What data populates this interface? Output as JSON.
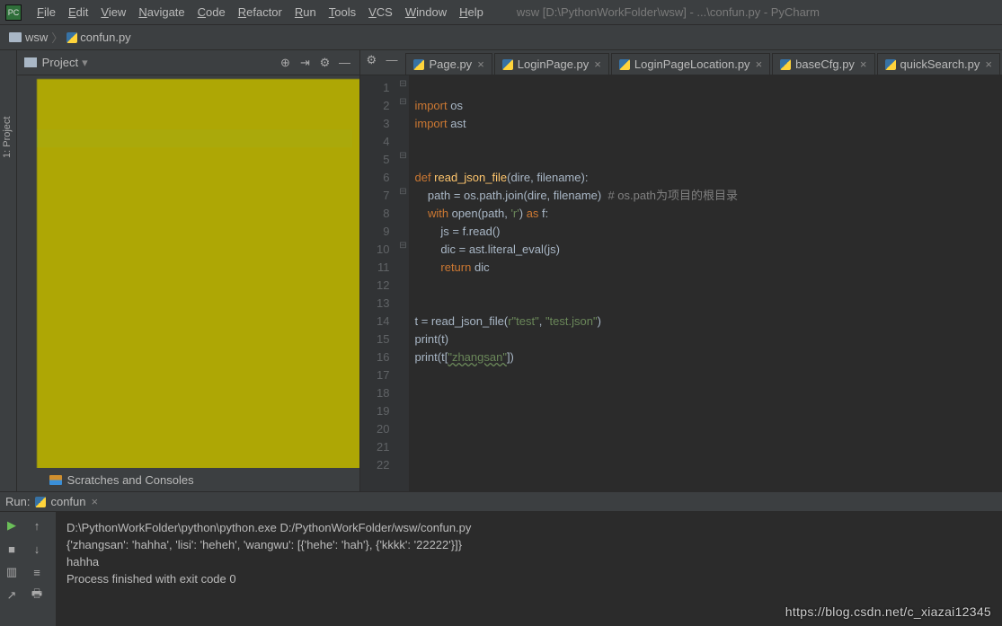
{
  "window_title": "wsw [D:\\PythonWorkFolder\\wsw] - ...\\confun.py - PyCharm",
  "menubar": [
    "File",
    "Edit",
    "View",
    "Navigate",
    "Code",
    "Refactor",
    "Run",
    "Tools",
    "VCS",
    "Window",
    "Help"
  ],
  "breadcrumb": {
    "folder": "wsw",
    "file": "confun.py"
  },
  "left_strip_label": "1: Project",
  "project_panel": {
    "title": "Project",
    "footer": "Scratches and Consoles"
  },
  "editor_tabs": [
    "Page.py",
    "LoginPage.py",
    "LoginPageLocation.py",
    "baseCfg.py",
    "quickSearch.py"
  ],
  "gutter_lines": [
    "1",
    "2",
    "3",
    "4",
    "5",
    "6",
    "7",
    "8",
    "9",
    "10",
    "11",
    "12",
    "13",
    "14",
    "15",
    "16",
    "17",
    "18",
    "19",
    "20",
    "21",
    "22"
  ],
  "fold_marks": {
    "1": "⊟",
    "2": "⊟",
    "5": "⊟",
    "7": "⊟",
    "10": "⊟"
  },
  "code": {
    "l1_a": "import",
    "l1_b": " os",
    "l2_a": "import",
    "l2_b": " ast",
    "l5_a": "def ",
    "l5_b": "read_json_file",
    "l5_c": "(dire, filename):",
    "l6_a": "    path = os.path.join(dire, filename)  ",
    "l6_b": "# os.path为项目的根目录",
    "l7_a": "    ",
    "l7_b": "with",
    "l7_c": " open(path, ",
    "l7_d": "'r'",
    "l7_e": ") ",
    "l7_f": "as",
    "l7_g": " f:",
    "l8": "        js = f.read()",
    "l9": "        dic = ast.literal_eval(js)",
    "l10_a": "        ",
    "l10_b": "return",
    "l10_c": " dic",
    "l13_a": "t = read_json_file(",
    "l13_b": "r\"test\"",
    "l13_c": ", ",
    "l13_d": "\"test.json\"",
    "l13_e": ")",
    "l14": "print(t)",
    "l15_a": "print(t[",
    "l15_b": "\"zhangsan\"",
    "l15_c": "])"
  },
  "run": {
    "label": "Run:",
    "tab": "confun",
    "out1": "D:\\PythonWorkFolder\\python\\python.exe D:/PythonWorkFolder/wsw/confun.py",
    "out2": "{'zhangsan': 'hahha', 'lisi': 'heheh', 'wangwu': [{'hehe': 'hah'}, {'kkkk': '22222'}]}",
    "out3": "hahha",
    "out4": "",
    "out5": "Process finished with exit code 0"
  },
  "watermark": "https://blog.csdn.net/c_xiazai12345"
}
